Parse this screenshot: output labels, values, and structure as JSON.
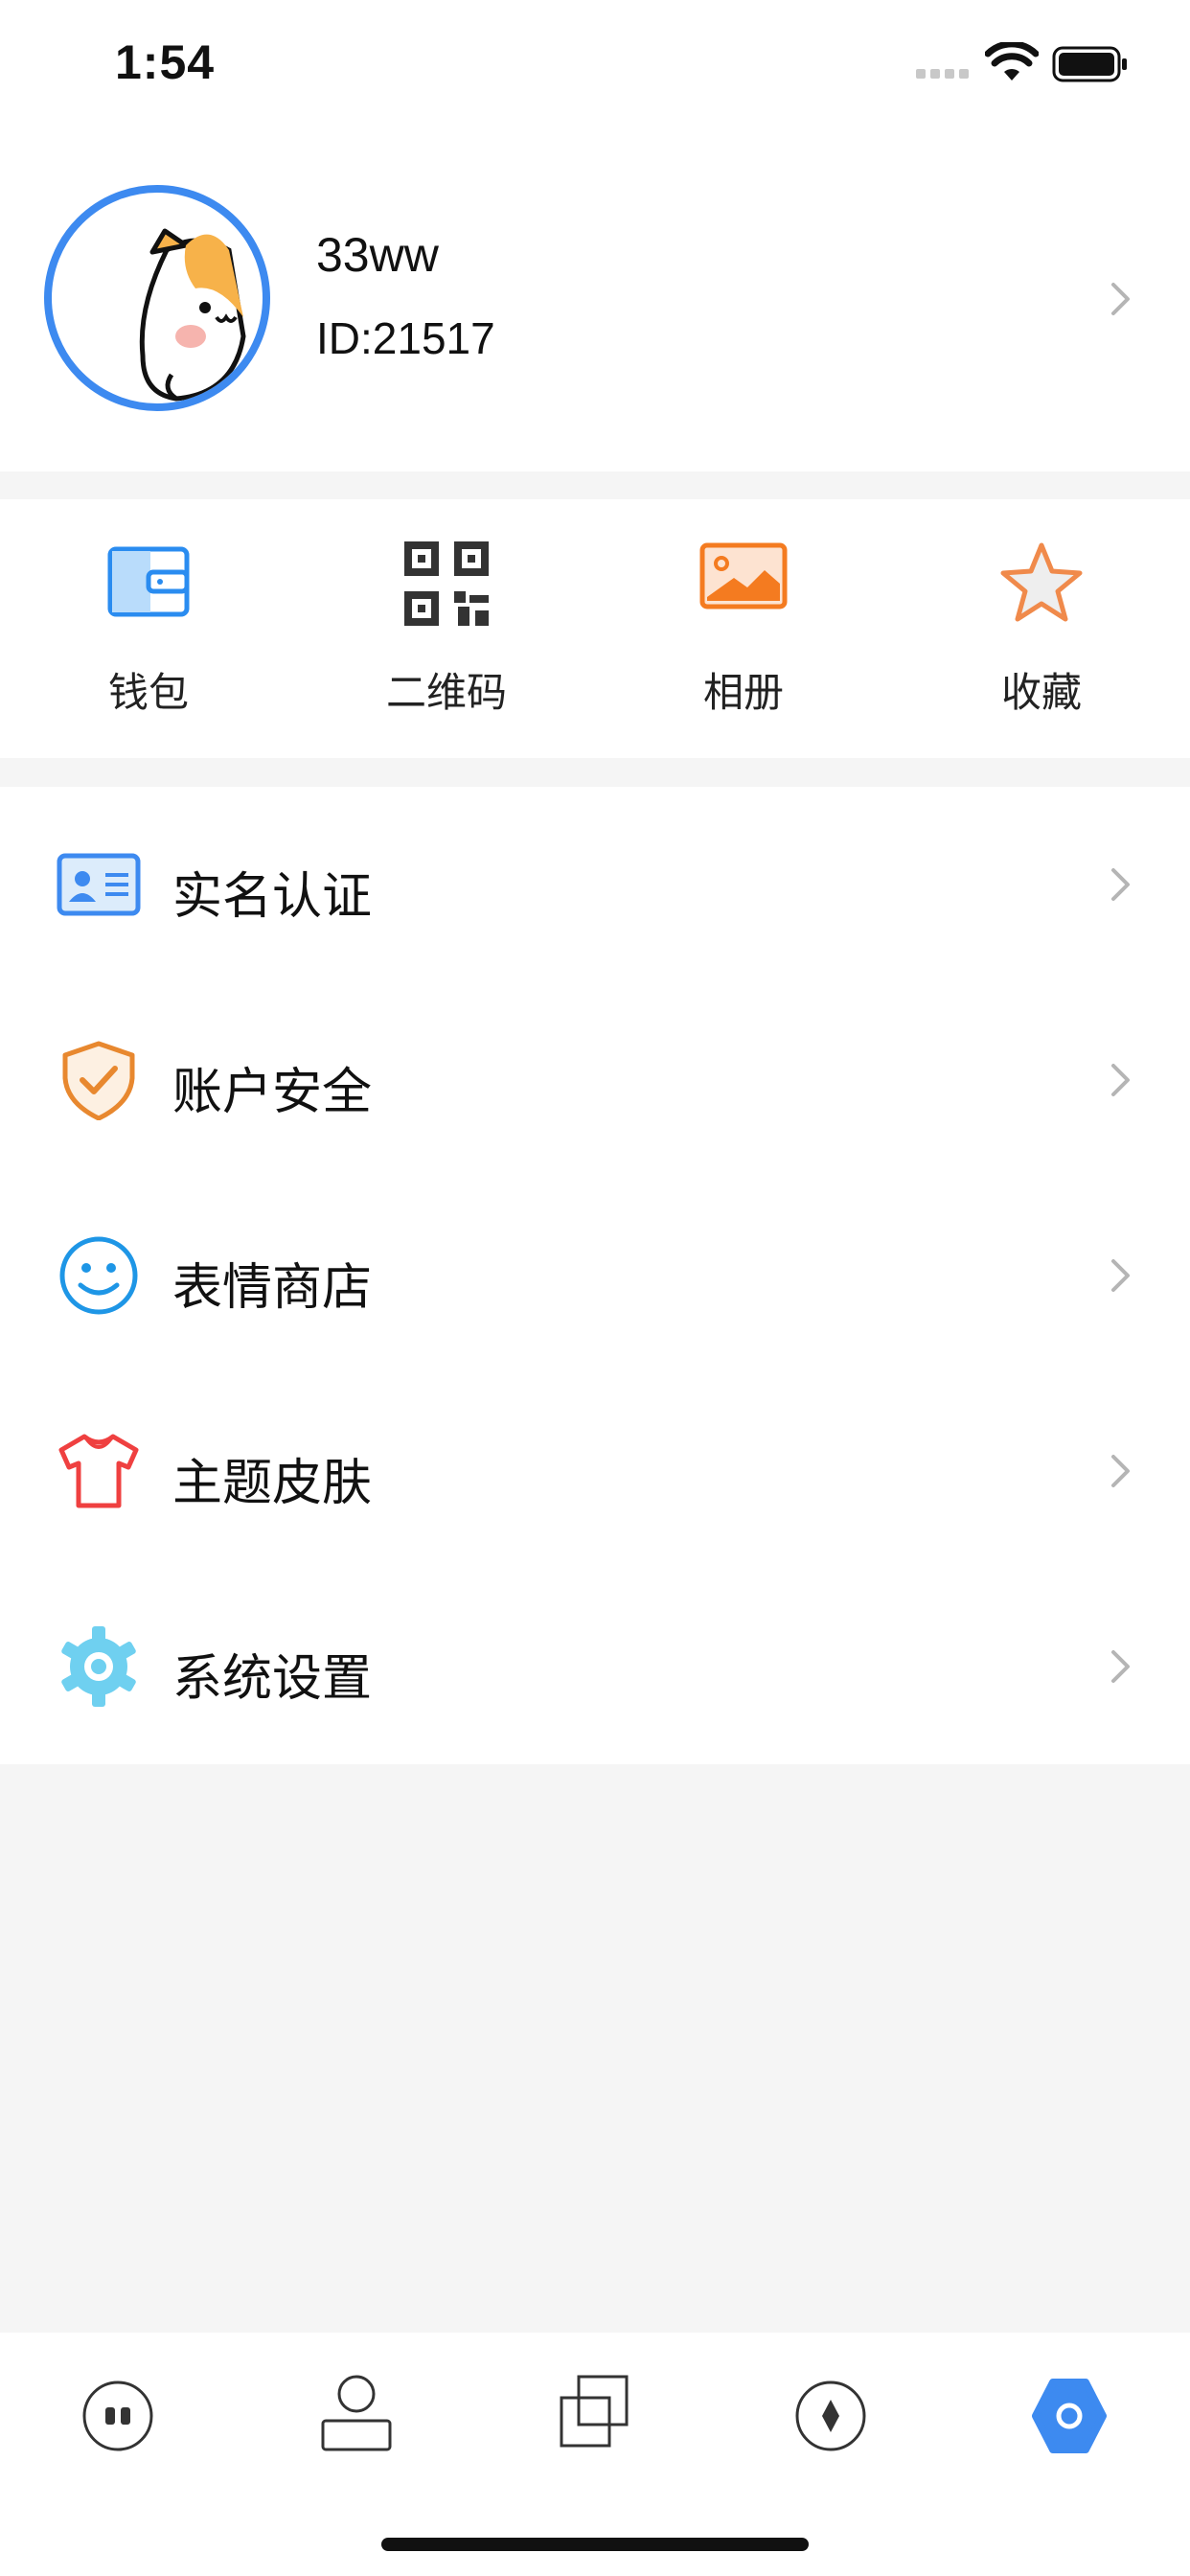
{
  "status_bar": {
    "time": "1:54"
  },
  "profile": {
    "username": "33ww",
    "user_id": "ID:21517"
  },
  "quick_actions": [
    {
      "label": "钱包",
      "icon": "wallet-icon"
    },
    {
      "label": "二维码",
      "icon": "qr-code-icon"
    },
    {
      "label": "相册",
      "icon": "photo-album-icon"
    },
    {
      "label": "收藏",
      "icon": "star-icon"
    }
  ],
  "menu": [
    {
      "label": "实名认证",
      "icon": "id-card-icon"
    },
    {
      "label": "账户安全",
      "icon": "shield-check-icon"
    },
    {
      "label": "表情商店",
      "icon": "smiley-icon"
    },
    {
      "label": "主题皮肤",
      "icon": "tshirt-icon"
    },
    {
      "label": "系统设置",
      "icon": "gear-icon"
    }
  ],
  "tab_bar": {
    "tabs": [
      {
        "icon": "chat-bubble-icon"
      },
      {
        "icon": "contacts-icon"
      },
      {
        "icon": "squares-icon"
      },
      {
        "icon": "compass-icon"
      },
      {
        "icon": "settings-hexagon-icon",
        "active": true
      }
    ],
    "active_color": "#3d8af0",
    "inactive_color": "#333333"
  },
  "colors": {
    "accent": "#3d8af0",
    "wallet": "#2a8cf0",
    "album": "#f47b20",
    "star": "#f08a4b",
    "shield": "#e8882f",
    "smiley": "#1e96e6",
    "tshirt": "#ef4040",
    "gear": "#6fd0f0"
  }
}
